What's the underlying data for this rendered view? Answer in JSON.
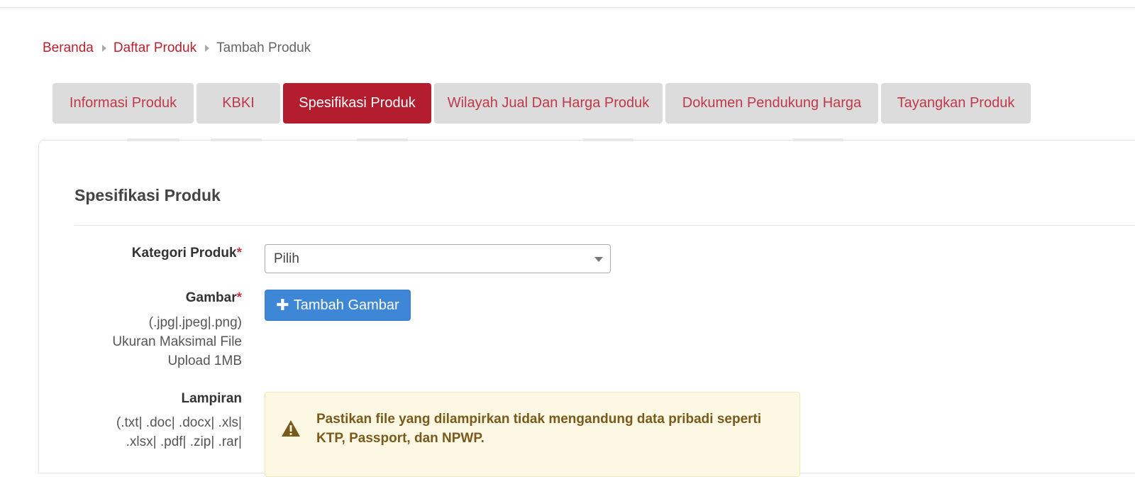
{
  "breadcrumb": {
    "home": "Beranda",
    "list": "Daftar Produk",
    "current": "Tambah Produk"
  },
  "tabs": [
    {
      "label": "Informasi Produk",
      "active": false
    },
    {
      "label": "KBKI",
      "active": false
    },
    {
      "label": "Spesifikasi Produk",
      "active": true
    },
    {
      "label": "Wilayah Jual Dan Harga Produk",
      "active": false
    },
    {
      "label": "Dokumen Pendukung Harga",
      "active": false
    },
    {
      "label": "Tayangkan Produk",
      "active": false
    }
  ],
  "section": {
    "title": "Spesifikasi Produk"
  },
  "form": {
    "kategori": {
      "label": "Kategori Produk",
      "required_mark": "*",
      "selected": "Pilih"
    },
    "gambar": {
      "label": "Gambar",
      "required_mark": "*",
      "hint_line1": "(.jpg|.jpeg|.png)",
      "hint_line2": "Ukuran Maksimal File",
      "hint_line3": "Upload 1MB",
      "button_icon": "plus-icon",
      "button_label": "Tambah Gambar"
    },
    "lampiran": {
      "label": "Lampiran",
      "hint_line1": "(.txt| .doc| .docx| .xls|",
      "hint_line2": ".xlsx| .pdf| .zip| .rar|",
      "alert_icon": "warning-icon",
      "alert_text": "Pastikan file yang dilampirkan tidak mengandung data pribadi seperti KTP, Passport, dan NPWP."
    }
  },
  "colors": {
    "brand_red": "#b41d2e",
    "link_red": "#c0394a",
    "button_blue": "#3e86d6",
    "tab_gray": "#dcdcdc",
    "alert_bg": "#fdf8e4",
    "alert_text": "#7a5a1a"
  }
}
